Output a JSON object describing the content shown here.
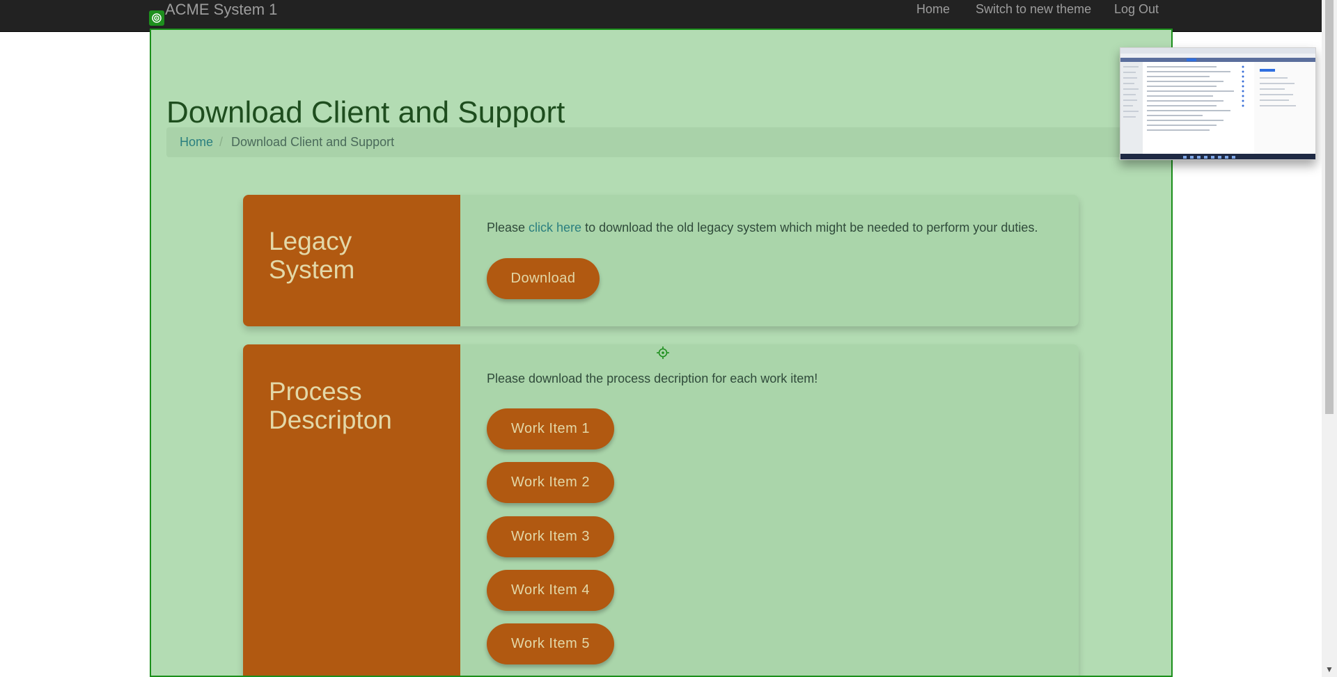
{
  "navbar": {
    "brand": "ACME System 1",
    "links": [
      "Home",
      "Switch to new theme",
      "Log Out"
    ]
  },
  "page": {
    "title": "Download Client and Support"
  },
  "breadcrumb": {
    "home": "Home",
    "separator": "/",
    "current": "Download Client and Support"
  },
  "legacy": {
    "title_line1": "Legacy",
    "title_line2": "System",
    "text_before": "Please ",
    "link": "click here",
    "text_after": " to download the old legacy system which might be needed to perform your duties.",
    "button": "Download"
  },
  "process": {
    "title_line1": "Process",
    "title_line2": "Descripton",
    "text": "Please download the process decription for each work item!",
    "buttons": [
      "Work Item 1",
      "Work Item 2",
      "Work Item 3",
      "Work Item 4",
      "Work Item 5"
    ]
  },
  "icons": {
    "corner": "target-icon",
    "crosshair": "crosshair-icon",
    "thumbnail": "screenshot-thumbnail"
  },
  "colors": {
    "navbar": "#222222",
    "overlay": "#b3dcb3",
    "accent": "#b15911",
    "accent_text": "#e3d8a8",
    "link": "#2a7f7f"
  }
}
